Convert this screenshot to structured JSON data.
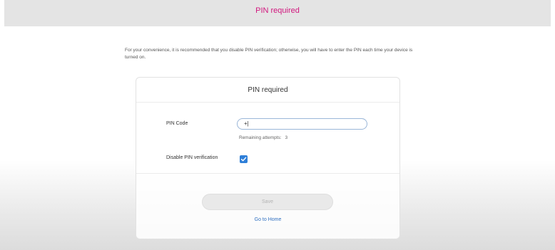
{
  "header": {
    "title": "PIN required"
  },
  "intro": {
    "text": "For your convenience, it is recommended that you disable PIN verification; otherwise, you will have to enter the PIN each time your device is turned on."
  },
  "card": {
    "title": "PIN required",
    "pin_label": "PIN Code",
    "pin_value": "+|",
    "remaining_label": "Remaining attempts:",
    "remaining_value": "3",
    "disable_label": "Disable PIN verification",
    "disable_checked": true,
    "save_label": "Save",
    "home_label": "Go to Home"
  },
  "colors": {
    "header_title": "#d1177e",
    "checkbox": "#2f7fd8",
    "link": "#2f6fc0",
    "input_border": "#9ab6d8"
  }
}
